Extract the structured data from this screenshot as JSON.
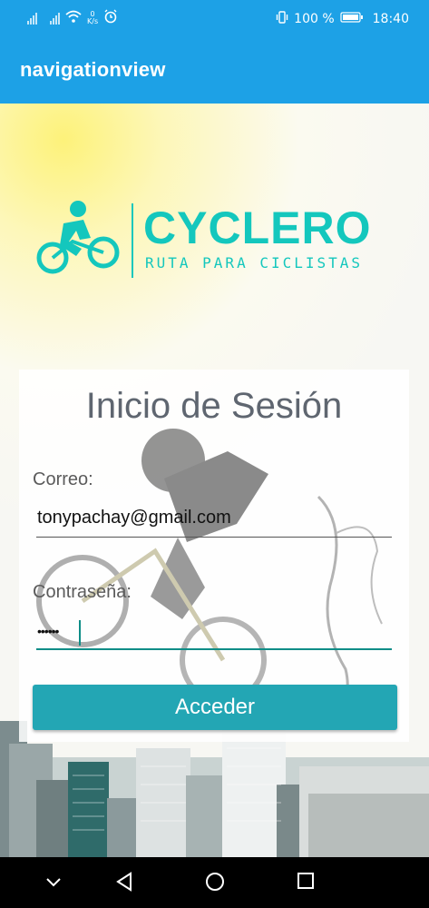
{
  "status_bar": {
    "net_speed_value": "0",
    "net_speed_unit": "K/s",
    "battery_text": "100 %",
    "time": "18:40",
    "icons": [
      "signal-icon",
      "signal-icon",
      "wifi-icon",
      "alarm-icon",
      "vibrate-icon",
      "battery-icon"
    ]
  },
  "app_bar": {
    "title": "navigationview"
  },
  "logo": {
    "name": "CYCLERO",
    "tagline": "RUTA PARA CICLISTAS",
    "brand_color": "#14c7bd",
    "icon": "cyclist-icon"
  },
  "login": {
    "title": "Inicio de Sesión",
    "email_label": "Correo:",
    "email_value": "tonypachay@gmail.com",
    "password_label": "Contraseña:",
    "password_value": "••••••",
    "submit_label": "Acceder",
    "accent_color": "#23a6b4"
  },
  "nav_bar": {
    "icons": [
      "chevron-down-icon",
      "back-icon",
      "home-icon",
      "recents-icon"
    ]
  }
}
